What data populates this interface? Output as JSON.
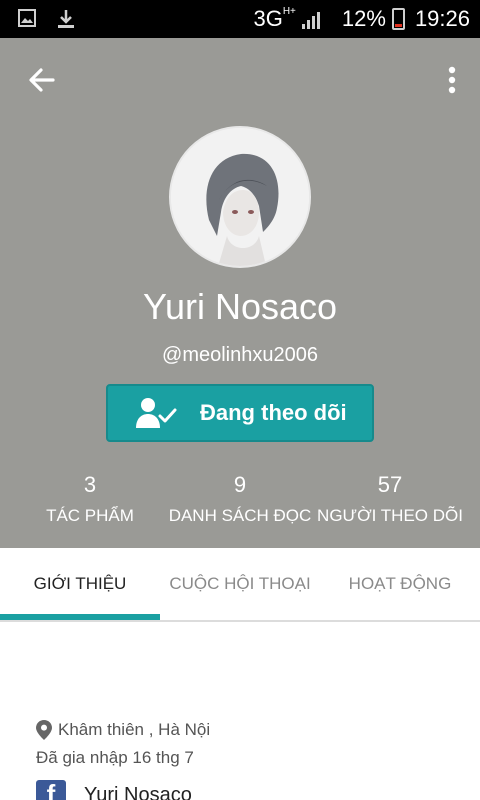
{
  "status_bar": {
    "network": "3G",
    "network_sup": "H+",
    "battery": "12%",
    "time": "19:26",
    "icons": [
      "image-icon",
      "download-icon",
      "signal-icon",
      "battery-icon"
    ]
  },
  "toolbar": {
    "back_icon": "back-arrow-icon",
    "menu_icon": "more-vertical-icon"
  },
  "profile": {
    "name": "Yuri Nosaco",
    "handle": "@meolinhxu2006",
    "follow_button": "Đang theo dõi",
    "follow_icon": "user-check-icon"
  },
  "stats": [
    {
      "value": "3",
      "label": "TÁC PHẨM"
    },
    {
      "value": "9",
      "label": "DANH SÁCH ĐỌC"
    },
    {
      "value": "57",
      "label": "NGƯỜI THEO DÕI"
    }
  ],
  "tabs": [
    {
      "label": "GIỚI THIỆU",
      "active": true
    },
    {
      "label": "CUỘC HỘI THOẠI",
      "active": false
    },
    {
      "label": "HOẠT ĐỘNG",
      "active": false
    }
  ],
  "about": {
    "location": "Khâm thiên , Hà Nội",
    "joined": "Đã gia nhập 16 thg 7",
    "facebook_name": "Yuri Nosaco",
    "facebook_icon_letter": "f"
  },
  "colors": {
    "accent": "#1aa0a2",
    "header_bg": "#9a9a96",
    "facebook": "#3b5998"
  }
}
